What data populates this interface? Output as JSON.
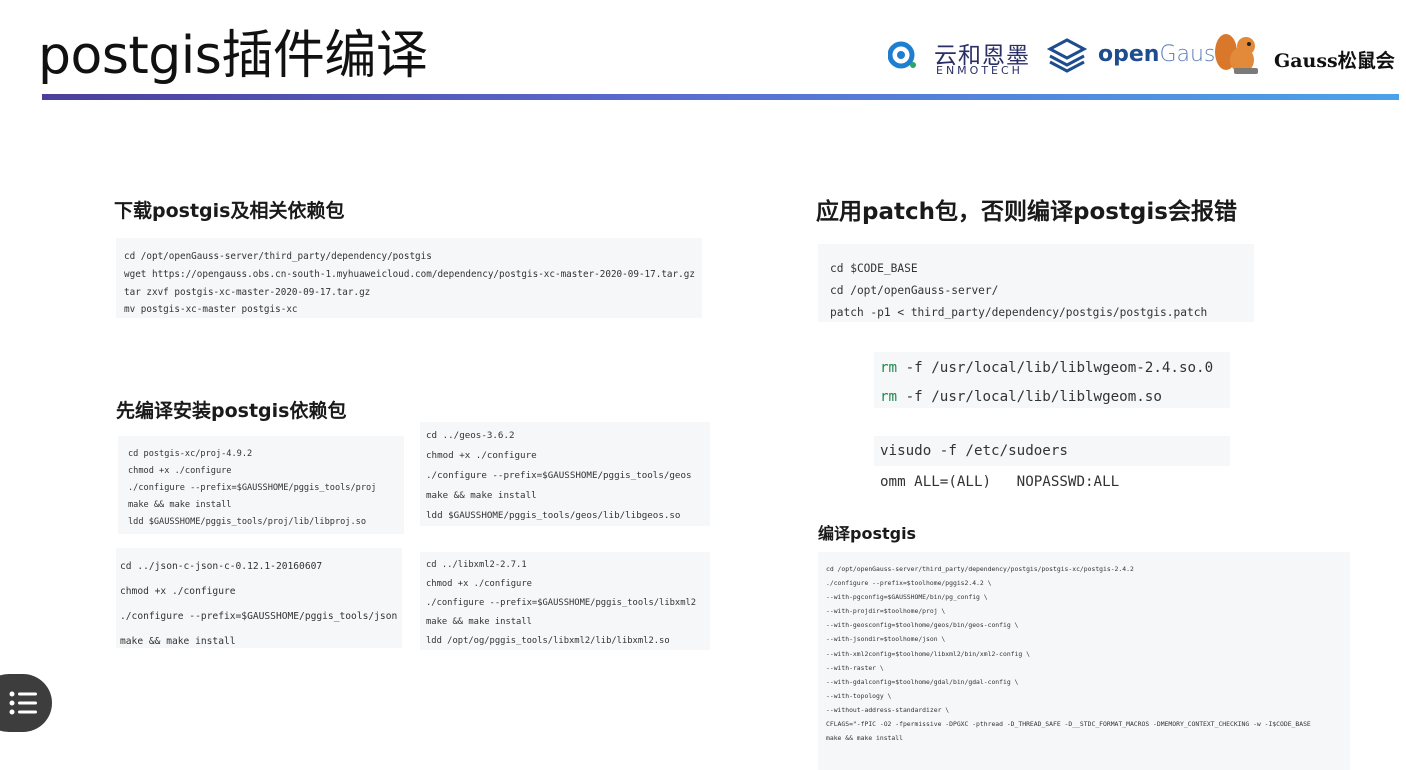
{
  "page": {
    "title": "postgis插件编译"
  },
  "logos": {
    "enmo_cn": "云和恩墨",
    "enmo_en": "ENMOTECH",
    "og_open": "open",
    "og_gauss": "Gauss",
    "gauss_club": "Gauss松鼠会"
  },
  "sections": {
    "download": {
      "heading": "下载postgis及相关依赖包",
      "lines": [
        "cd /opt/openGauss-server/third_party/dependency/postgis",
        "wget https://opengauss.obs.cn-south-1.myhuaweicloud.com/dependency/postgis-xc-master-2020-09-17.tar.gz",
        "tar zxvf postgis-xc-master-2020-09-17.tar.gz",
        "mv postgis-xc-master postgis-xc"
      ]
    },
    "deps": {
      "heading": "先编译安装postgis依赖包",
      "proj": [
        "cd postgis-xc/proj-4.9.2",
        "chmod +x ./configure",
        "./configure --prefix=$GAUSSHOME/pggis_tools/proj",
        "make && make install",
        "ldd $GAUSSHOME/pggis_tools/proj/lib/libproj.so"
      ],
      "geos": [
        "cd ../geos-3.6.2",
        "chmod +x ./configure",
        "./configure --prefix=$GAUSSHOME/pggis_tools/geos",
        "make && make install",
        "ldd $GAUSSHOME/pggis_tools/geos/lib/libgeos.so"
      ],
      "json": [
        "cd ../json-c-json-c-0.12.1-20160607",
        "chmod +x ./configure",
        "./configure --prefix=$GAUSSHOME/pggis_tools/json",
        "make && make install"
      ],
      "libxml": [
        "cd ../libxml2-2.7.1",
        "chmod +x ./configure",
        "./configure --prefix=$GAUSSHOME/pggis_tools/libxml2",
        "make && make install",
        "ldd /opt/og/pggis_tools/libxml2/lib/libxml2.so"
      ]
    },
    "patch": {
      "heading": "应用patch包，否则编译postgis会报错",
      "lines": [
        "cd $CODE_BASE",
        "cd /opt/openGauss-server/",
        "patch -p1 < third_party/dependency/postgis/postgis.patch"
      ],
      "rm_cmd": "rm",
      "rm_lines": [
        " -f /usr/local/lib/liblwgeom-2.4.so.0",
        " -f /usr/local/lib/liblwgeom.so"
      ],
      "visudo": "visudo -f /etc/sudoers",
      "omm": "omm ALL=(ALL)   NOPASSWD:ALL"
    },
    "compile": {
      "heading": "编译postgis",
      "lines": [
        "cd /opt/openGauss-server/third_party/dependency/postgis/postgis-xc/postgis-2.4.2",
        "",
        "./configure --prefix=$toolhome/pggis2.4.2 \\",
        "--with-pgconfig=$GAUSSHOME/bin/pg_config \\",
        "--with-projdir=$toolhome/proj \\",
        "--with-geosconfig=$toolhome/geos/bin/geos-config \\",
        "--with-jsondir=$toolhome/json \\",
        "--with-xml2config=$toolhome/libxml2/bin/xml2-config \\",
        "--with-raster \\",
        "--with-gdalconfig=$toolhome/gdal/bin/gdal-config \\",
        "--with-topology \\",
        "--without-address-standardizer \\",
        "CFLAGS=\"-fPIC -O2 -fpermissive -DPGXC -pthread -D_THREAD_SAFE -D__STDC_FORMAT_MACROS -DMEMORY_CONTEXT_CHECKING -w -I$CODE_BASE",
        "",
        "make && make install"
      ]
    }
  },
  "colors": {
    "accent": "#5a6bd0",
    "rm": "#1f8a4c"
  },
  "icons": {
    "menu": "list-menu-icon",
    "enmo": "enmo-logo-icon",
    "opengauss": "opengauss-logo-icon",
    "squirrel": "squirrel-logo-icon"
  }
}
